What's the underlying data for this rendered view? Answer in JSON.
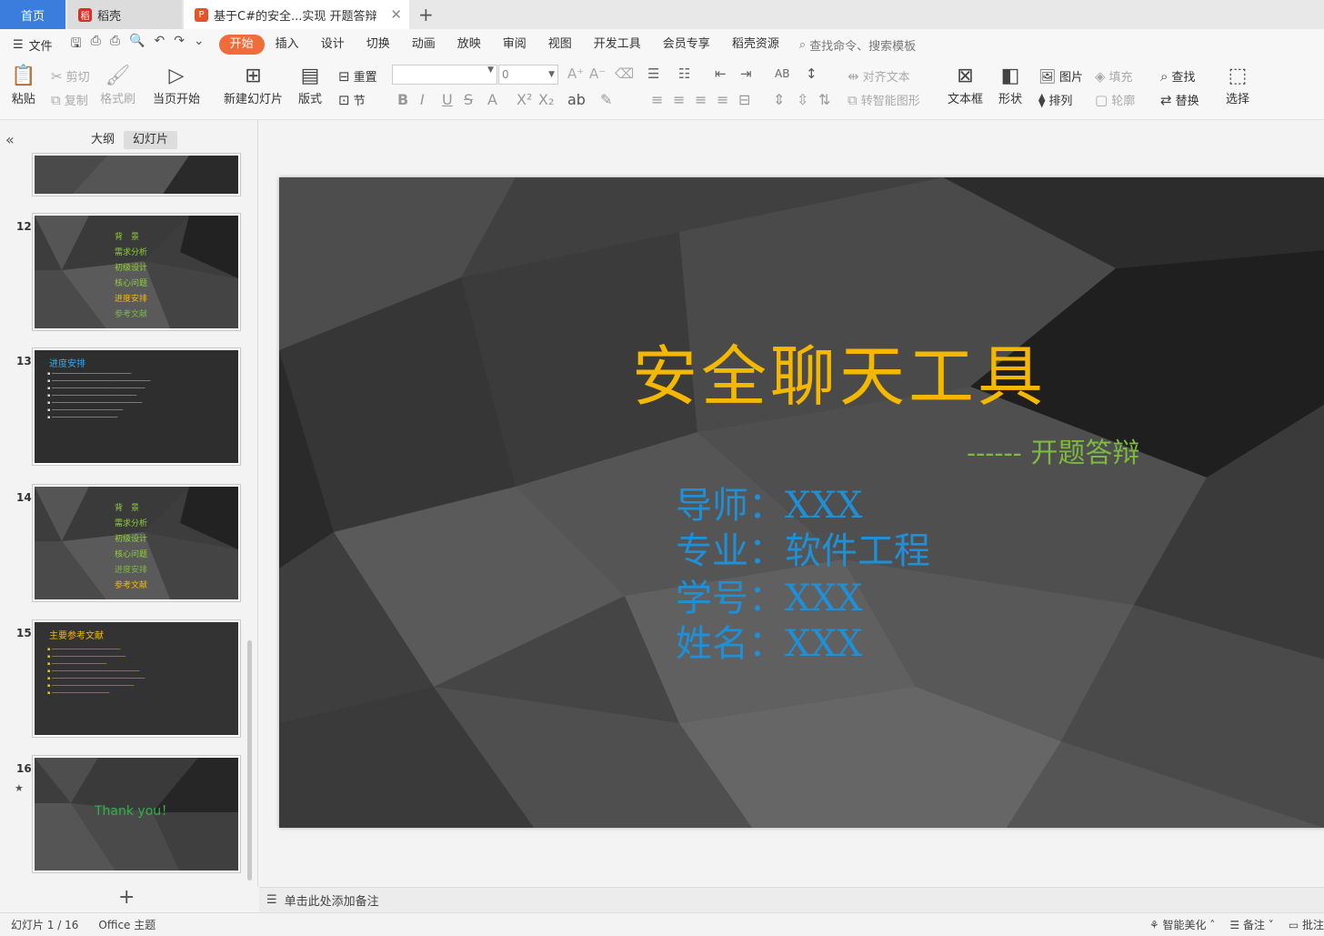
{
  "tabs": {
    "home": "首页",
    "daoke": "稻壳",
    "doc": "基于C#的安全...实现 开题答辩"
  },
  "menubar": {
    "file": "文件",
    "menus": [
      "开始",
      "插入",
      "设计",
      "切换",
      "动画",
      "放映",
      "审阅",
      "视图",
      "开发工具",
      "会员专享",
      "稻壳资源"
    ],
    "search": "查找命令、搜索模板"
  },
  "ribbon": {
    "paste": "粘贴",
    "cut": "剪切",
    "copy": "复制",
    "format_painter": "格式刷",
    "from_current": "当页开始",
    "new_slide": "新建幻灯片",
    "layout": "版式",
    "reset": "重置",
    "section": "节",
    "font_size": "0",
    "align_text": "对齐文本",
    "to_smartart": "转智能图形",
    "textbox": "文本框",
    "shape": "形状",
    "picture": "图片",
    "arrange": "排列",
    "fill": "填充",
    "outline": "轮廓",
    "find": "查找",
    "replace": "替换",
    "select": "选择"
  },
  "panel": {
    "outline_tab": "大纲",
    "slides_tab": "幻灯片"
  },
  "thumbs": {
    "t12": {
      "num": "12",
      "items": [
        "背　景",
        "需求分析",
        "初级设计",
        "核心问题",
        "进度安排",
        "参考文献"
      ]
    },
    "t13": {
      "num": "13",
      "title": "进度安排"
    },
    "t14": {
      "num": "14",
      "items": [
        "背　景",
        "需求分析",
        "初级设计",
        "核心问题",
        "进度安排",
        "参考文献"
      ]
    },
    "t15": {
      "num": "15",
      "title": "主要参考文献"
    },
    "t16": {
      "num": "16",
      "title": "Thank you！"
    }
  },
  "slide": {
    "title": "安全聊天工具",
    "subtitle": "------ 开题答辩",
    "lines": [
      "导师：XXX",
      "专业：软件工程",
      "学号：XXX",
      "姓名：XXX"
    ]
  },
  "notes": {
    "placeholder": "单击此处添加备注"
  },
  "status": {
    "slide_index": "幻灯片 1 / 16",
    "theme": "Office 主题",
    "beautify": "智能美化",
    "notes_btn": "备注",
    "comment_btn": "批注"
  },
  "colors": {
    "accent": "#f26b3a",
    "title": "#f5b800",
    "subtitle": "#7cb93e",
    "info": "#1f8fd6"
  }
}
